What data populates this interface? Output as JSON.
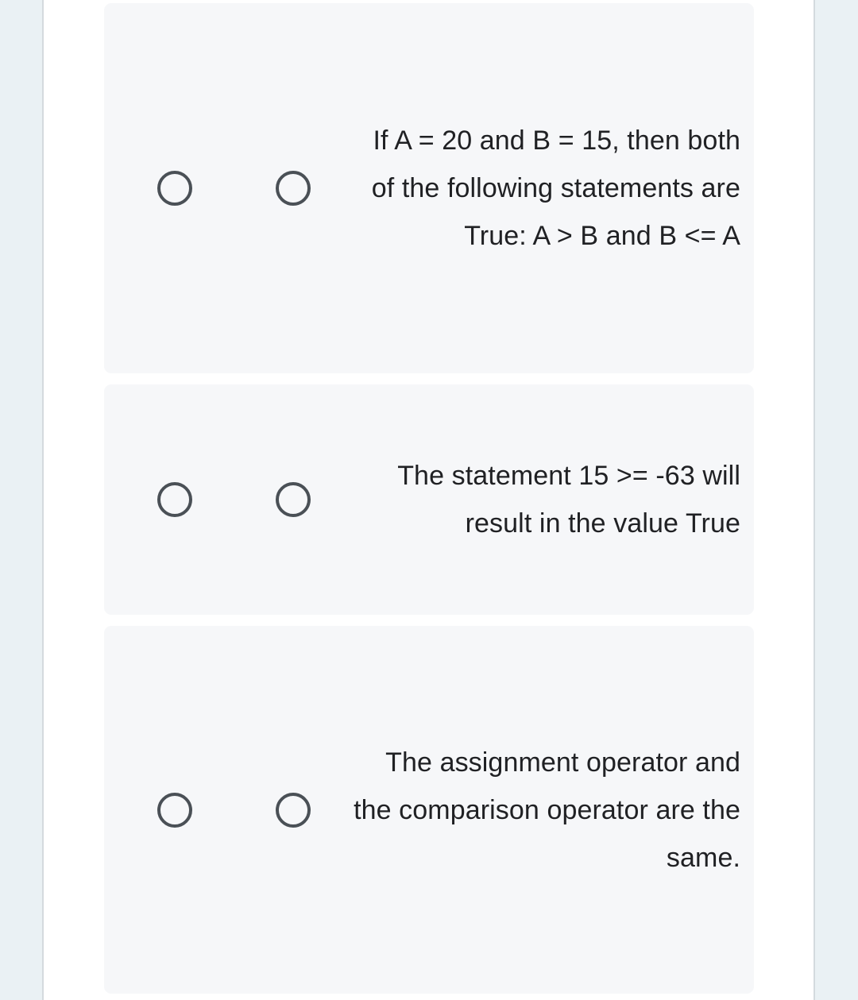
{
  "page": {
    "background_color": "#ffffff",
    "gutter_color": "#eaf1f4",
    "rule_color": "#d4dade",
    "card_color": "#f6f7f9",
    "text_color": "#202124",
    "radio_color": "#4a5056"
  },
  "questions": [
    {
      "id": "q1",
      "statement": "If A = 20 and B = 15, then both of the following statements are True: A > B and B <= A",
      "options": [
        {
          "id": "q1-opt1",
          "selected": false
        },
        {
          "id": "q1-opt2",
          "selected": false
        }
      ]
    },
    {
      "id": "q2",
      "statement": "The statement 15 >= -63 will result in the value True",
      "options": [
        {
          "id": "q2-opt1",
          "selected": false
        },
        {
          "id": "q2-opt2",
          "selected": false
        }
      ]
    },
    {
      "id": "q3",
      "statement": "The assignment operator and the comparison operator are the same.",
      "options": [
        {
          "id": "q3-opt1",
          "selected": false
        },
        {
          "id": "q3-opt2",
          "selected": false
        }
      ]
    }
  ]
}
